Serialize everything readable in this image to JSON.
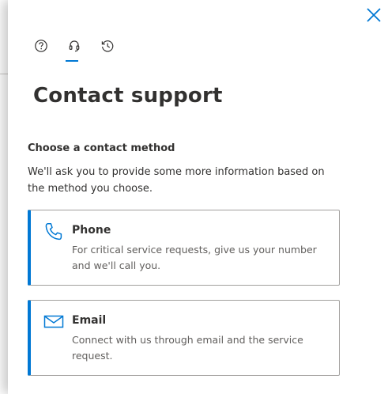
{
  "panel": {
    "title": "Contact support",
    "tabs": [
      {
        "icon": "help-icon",
        "label": "",
        "selected": false
      },
      {
        "icon": "headset-icon",
        "label": "",
        "selected": true
      },
      {
        "icon": "history-icon",
        "label": "",
        "selected": false
      }
    ],
    "section_heading": "Choose a contact method",
    "description": "We'll ask you to provide some more information based on the method you choose.",
    "options": [
      {
        "icon": "phone-icon",
        "title": "Phone",
        "text": "For critical service requests, give us your number and we'll call you."
      },
      {
        "icon": "email-icon",
        "title": "Email",
        "text": "Connect with us through email and the service request."
      }
    ]
  },
  "colors": {
    "accent": "#0078d4",
    "text_primary": "#323130",
    "text_secondary": "#605e5c",
    "border": "#a19f9d"
  }
}
